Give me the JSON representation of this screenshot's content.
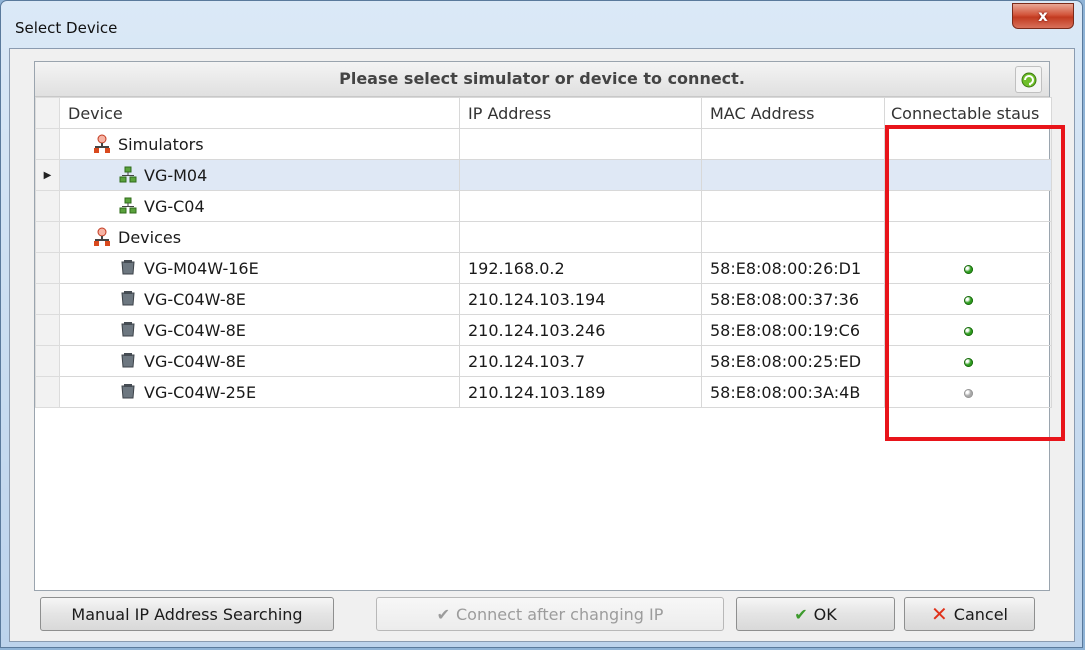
{
  "window": {
    "title": "Select Device",
    "close_label": "x"
  },
  "panel": {
    "header": "Please select simulator or device to connect."
  },
  "columns": [
    "Device",
    "IP Address",
    "MAC Address",
    "Connectable staus"
  ],
  "rows": [
    {
      "name": "Simulators",
      "ip": "",
      "mac": "",
      "status": "",
      "icon": "network-group-icon"
    },
    {
      "name": "VG-M04",
      "ip": "",
      "mac": "",
      "status": "",
      "icon": "network-node-icon"
    },
    {
      "name": "VG-C04",
      "ip": "",
      "mac": "",
      "status": "",
      "icon": "network-node-icon"
    },
    {
      "name": "Devices",
      "ip": "",
      "mac": "",
      "status": "",
      "icon": "network-group-icon"
    },
    {
      "name": "VG-M04W-16E",
      "ip": "192.168.0.2",
      "mac": "58:E8:08:00:26:D1",
      "status": "connectable",
      "icon": "device-icon"
    },
    {
      "name": "VG-C04W-8E",
      "ip": "210.124.103.194",
      "mac": "58:E8:08:00:37:36",
      "status": "connectable",
      "icon": "device-icon"
    },
    {
      "name": "VG-C04W-8E",
      "ip": "210.124.103.246",
      "mac": "58:E8:08:00:19:C6",
      "status": "connectable",
      "icon": "device-icon"
    },
    {
      "name": "VG-C04W-8E",
      "ip": "210.124.103.7",
      "mac": "58:E8:08:00:25:ED",
      "status": "connectable",
      "icon": "device-icon"
    },
    {
      "name": "VG-C04W-25E",
      "ip": "210.124.103.189",
      "mac": "58:E8:08:00:3A:4B",
      "status": "unavailable",
      "icon": "device-icon"
    }
  ],
  "buttons": {
    "manual": "Manual IP Address Searching",
    "connect_change": "Connect after changing IP",
    "ok": "OK",
    "cancel": "Cancel"
  },
  "colors": {
    "status_connectable": "#2e9d1e",
    "status_unavailable": "#a8a8a8",
    "highlight": "#e8141a"
  }
}
